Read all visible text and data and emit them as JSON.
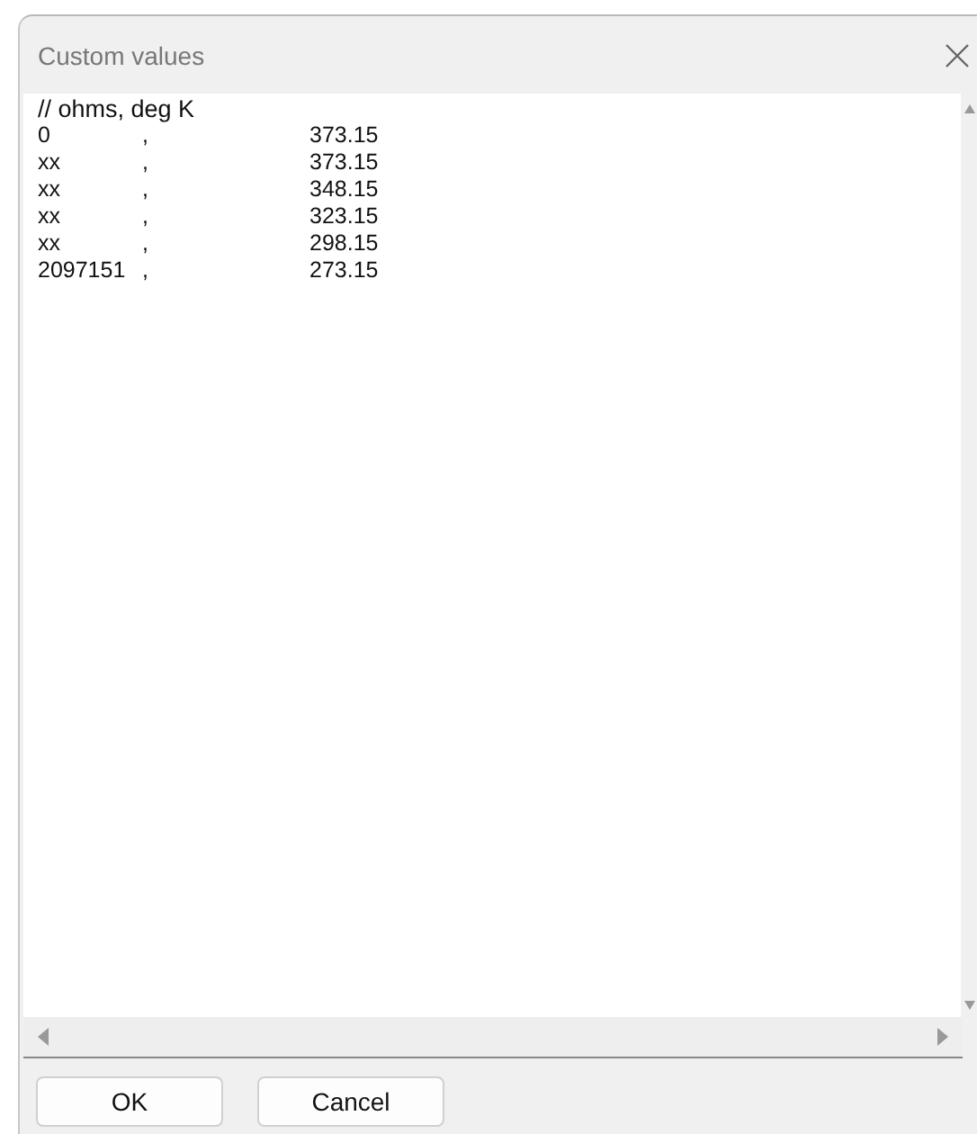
{
  "window": {
    "title": "Custom values"
  },
  "editor": {
    "lines": [
      {
        "kind": "comment",
        "text": "// ohms, deg K"
      },
      {
        "kind": "row",
        "cells": [
          "0",
          ",",
          "373.15"
        ]
      },
      {
        "kind": "row",
        "cells": [
          "xx",
          ",",
          "373.15"
        ]
      },
      {
        "kind": "row",
        "cells": [
          "xx",
          ",",
          "348.15"
        ]
      },
      {
        "kind": "row",
        "cells": [
          "xx",
          ",",
          "323.15"
        ]
      },
      {
        "kind": "row",
        "cells": [
          "xx",
          ",",
          "298.15"
        ]
      },
      {
        "kind": "row",
        "cells": [
          "2097151",
          ",",
          "273.15"
        ]
      }
    ]
  },
  "buttons": [
    "OK",
    "Cancel"
  ]
}
